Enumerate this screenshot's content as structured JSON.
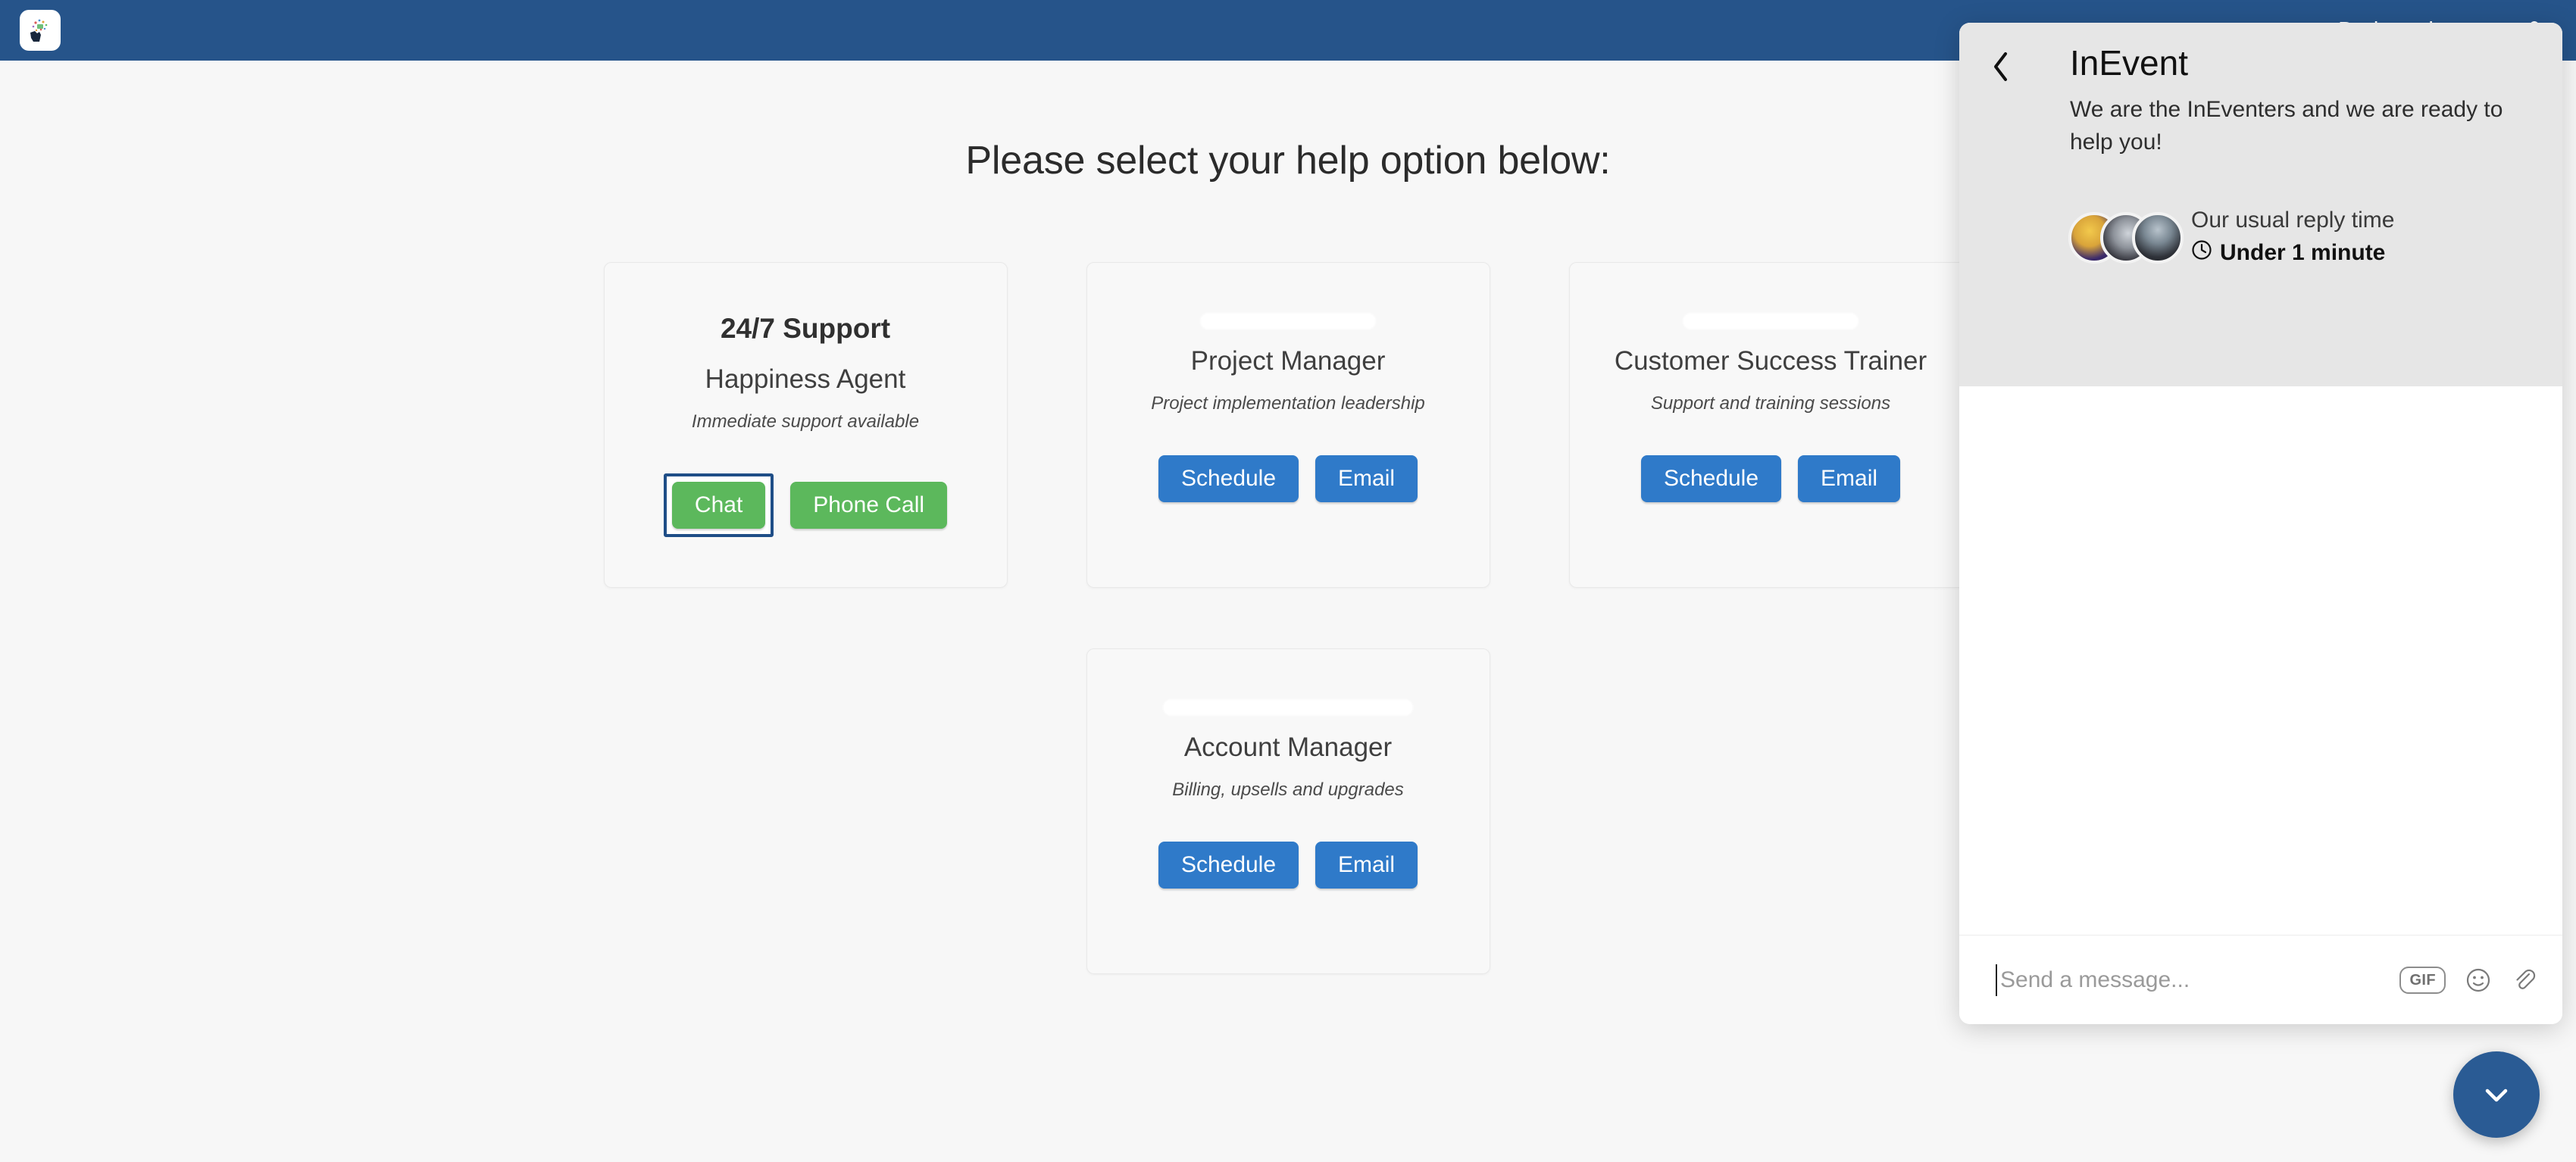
{
  "navbar": {
    "logo_alt": "InEvent logo",
    "links": [
      {
        "label": "Dark mode",
        "icon": "toggle-icon"
      }
    ],
    "bg_color": "#26548a"
  },
  "main": {
    "title": "Please select your help option below:",
    "background_color": "#f7f7f7",
    "cards": [
      {
        "id": "support-247",
        "title": "24/7 Support",
        "name_redacted": false,
        "role": "Happiness Agent",
        "description": "Immediate support available",
        "actions": [
          {
            "label": "Chat",
            "style": "green",
            "focused": true
          },
          {
            "label": "Phone Call",
            "style": "green",
            "focused": false
          }
        ]
      },
      {
        "id": "project-manager",
        "title": "",
        "name_redacted": true,
        "role": "Project Manager",
        "description": "Project implementation leadership",
        "actions": [
          {
            "label": "Schedule",
            "style": "blue",
            "focused": false
          },
          {
            "label": "Email",
            "style": "blue",
            "focused": false
          }
        ]
      },
      {
        "id": "customer-success-trainer",
        "title": "",
        "name_redacted": true,
        "role": "Customer Success Trainer",
        "description": "Support and training sessions",
        "actions": [
          {
            "label": "Schedule",
            "style": "blue",
            "focused": false
          },
          {
            "label": "Email",
            "style": "blue",
            "focused": false
          }
        ]
      },
      {
        "id": "account-manager",
        "title": "",
        "name_redacted": true,
        "role": "Account Manager",
        "description": "Billing, upsells and upgrades",
        "actions": [
          {
            "label": "Schedule",
            "style": "blue",
            "focused": false
          },
          {
            "label": "Email",
            "style": "blue",
            "focused": false
          }
        ]
      }
    ]
  },
  "chat_widget": {
    "back_icon": "chevron-left-icon",
    "brand": "InEvent",
    "tagline": "We are the InEventers and we are ready to help you!",
    "reply_label": "Our usual reply time",
    "reply_value": "Under 1 minute",
    "reply_icon": "clock-icon",
    "avatar_count": 3,
    "input_placeholder": "Send a message...",
    "footer_icons": [
      {
        "name": "gif-icon",
        "label": "GIF"
      },
      {
        "name": "emoji-icon",
        "label": ""
      },
      {
        "name": "attachment-icon",
        "label": ""
      }
    ]
  },
  "fab": {
    "icon": "chevron-down-icon",
    "color": "#2a5b94"
  },
  "colors": {
    "navbar": "#26548a",
    "green_button": "#5cb85c",
    "blue_button": "#2f7ac9",
    "focus_ring": "#1f4e87",
    "page_bg": "#f7f7f7",
    "card_bg": "#f8f8f8"
  }
}
